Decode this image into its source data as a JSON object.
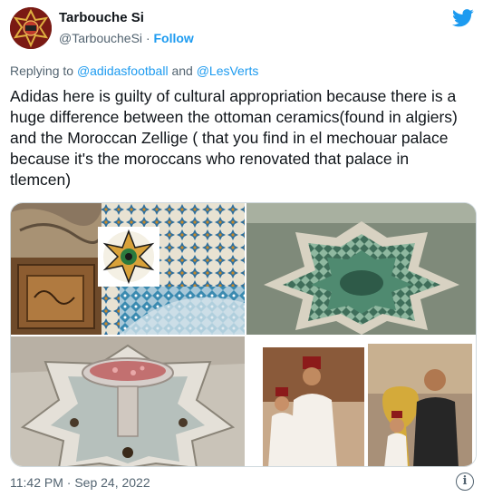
{
  "author": {
    "display_name": "Tarbouche Si",
    "handle": "@TarboucheSi",
    "separator": "·",
    "follow_label": "Follow"
  },
  "reply": {
    "prefix": "Replying to",
    "mention_1": "@adidasfootball",
    "conjunction": "and",
    "mention_2": "@LesVerts"
  },
  "tweet": {
    "text": "Adidas here is guilty of cultural appropriation because there is a huge difference between the ottoman ceramics(found in algiers) and the Moroccan Zellige ( that you find in el mechouar palace because it's the moroccans who renovated that palace in tlemcen)"
  },
  "meta": {
    "timestamp": "11:42 PM · Sep 24, 2022",
    "info_icon": "i"
  },
  "icons": {
    "brand": "twitter-bird-icon",
    "info": "info-icon"
  },
  "colors": {
    "link": "#1d9bf0",
    "secondary_text": "#536471",
    "primary_text": "#0f1419",
    "border": "#cfd9de"
  }
}
